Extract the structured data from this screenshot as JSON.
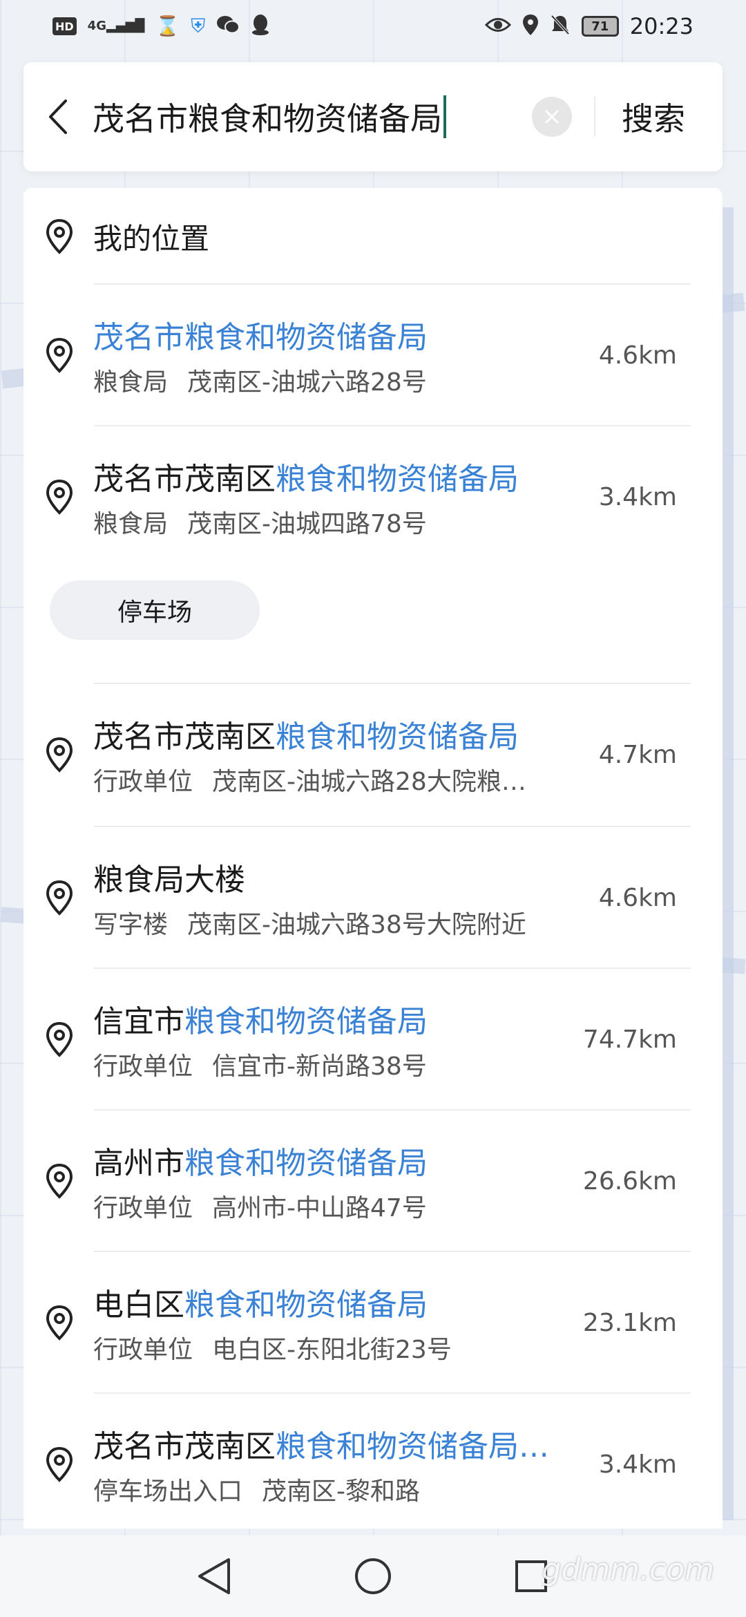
{
  "status_bar": {
    "hd": "HD",
    "signal": "4G",
    "battery": "71",
    "time": "20:23",
    "icons_left": [
      "hd-icon",
      "signal-icon",
      "hourglass-icon",
      "shield-icon",
      "wechat-icon",
      "qq-icon"
    ],
    "icons_right": [
      "eye-icon",
      "location-icon",
      "mute-icon",
      "battery-icon"
    ]
  },
  "search": {
    "query": "茂名市粮食和物资储备局",
    "button_label": "搜索"
  },
  "my_location": {
    "label": "我的位置"
  },
  "results": [
    {
      "title_plain": "",
      "title_highlight": "茂名市粮食和物资储备局",
      "category": "粮食局",
      "address": "茂南区-油城六路28号",
      "distance": "4.6km"
    },
    {
      "title_plain": "茂名市茂南区",
      "title_highlight": "粮食和物资储备局",
      "category": "粮食局",
      "address": "茂南区-油城四路78号",
      "distance": "3.4km"
    },
    {
      "title_plain": "茂名市茂南区",
      "title_highlight": "粮食和物资储备局",
      "category": "行政单位",
      "address": "茂南区-油城六路28大院粮…",
      "distance": "4.7km"
    },
    {
      "title_plain": "粮食局大楼",
      "title_highlight": "",
      "category": "写字楼",
      "address": "茂南区-油城六路38号大院附近",
      "distance": "4.6km"
    },
    {
      "title_plain": "信宜市",
      "title_highlight": "粮食和物资储备局",
      "category": "行政单位",
      "address": "信宜市-新尚路38号",
      "distance": "74.7km"
    },
    {
      "title_plain": "高州市",
      "title_highlight": "粮食和物资储备局",
      "category": "行政单位",
      "address": "高州市-中山路47号",
      "distance": "26.6km"
    },
    {
      "title_plain": "电白区",
      "title_highlight": "粮食和物资储备局",
      "category": "行政单位",
      "address": "电白区-东阳北街23号",
      "distance": "23.1km"
    },
    {
      "title_plain": "茂名市茂南区",
      "title_highlight": "粮食和物资储备局…",
      "category": "停车场出入口",
      "address": "茂南区-黎和路",
      "distance": "3.4km"
    }
  ],
  "sub_poi_chip": {
    "label": "停车场"
  },
  "watermark": "gdmm.com",
  "colors": {
    "highlight": "#3a82d6",
    "caret": "#1a6b5e",
    "background": "#eef1f6"
  }
}
